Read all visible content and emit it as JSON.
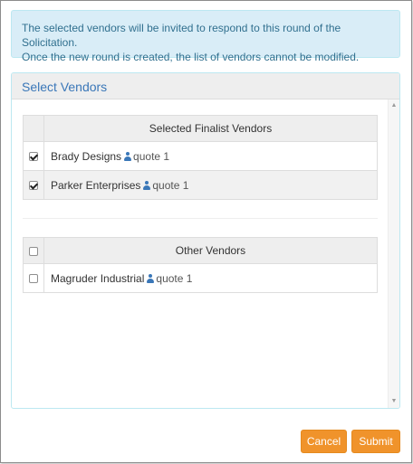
{
  "alert": {
    "line1": "The selected vendors will be invited to respond to this round of the Solicitation.",
    "line2": "Once the new round is created, the list of vendors cannot be modified."
  },
  "panel": {
    "title": "Select Vendors"
  },
  "finalist_table": {
    "header": "Selected Finalist Vendors",
    "header_checked": false,
    "rows": [
      {
        "name": "Brady Designs",
        "icon": "person-icon",
        "quote": "quote 1",
        "checked": true
      },
      {
        "name": "Parker Enterprises",
        "icon": "person-icon",
        "quote": "quote 1",
        "checked": true
      }
    ]
  },
  "other_table": {
    "header": "Other Vendors",
    "header_checked": false,
    "rows": [
      {
        "name": "Magruder Industrial",
        "icon": "person-icon",
        "quote": "quote 1",
        "checked": false
      }
    ]
  },
  "buttons": {
    "cancel": "Cancel",
    "submit": "Submit"
  },
  "colors": {
    "accent": "#f0932b",
    "link_blue": "#3a77b8",
    "alert_bg": "#d9edf7",
    "alert_text": "#31708f"
  }
}
